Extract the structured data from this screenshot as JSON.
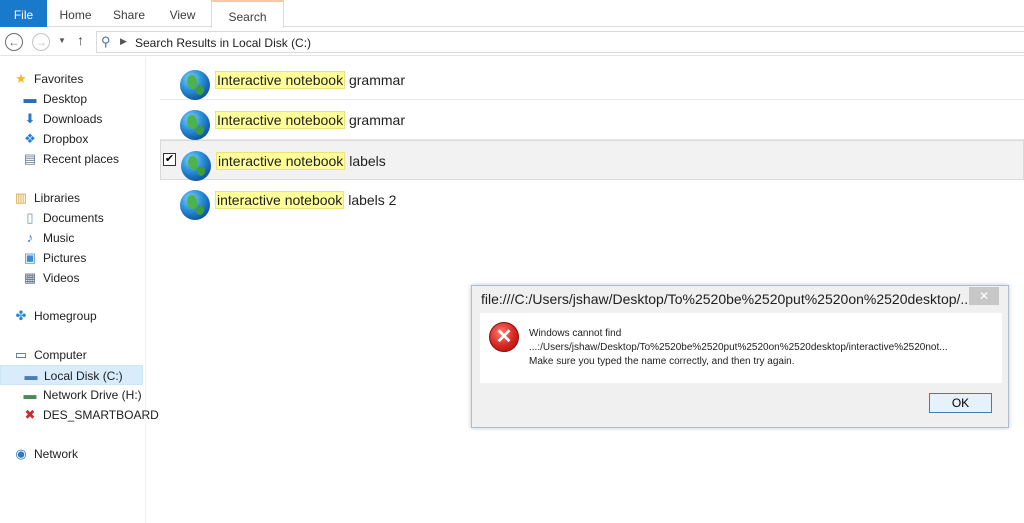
{
  "ribbon": {
    "tabs": [
      "File",
      "Home",
      "Share",
      "View",
      "Search"
    ]
  },
  "address": {
    "path": "Search Results in Local Disk (C:)"
  },
  "navpane": {
    "favorites": {
      "label": "Favorites",
      "items": [
        "Desktop",
        "Downloads",
        "Dropbox",
        "Recent places"
      ]
    },
    "libraries": {
      "label": "Libraries",
      "items": [
        "Documents",
        "Music",
        "Pictures",
        "Videos"
      ]
    },
    "homegroup": {
      "label": "Homegroup"
    },
    "computer": {
      "label": "Computer",
      "items": [
        "Local Disk (C:)",
        "Network Drive (H:)",
        "DES_SMARTBOARD"
      ]
    },
    "network": {
      "label": "Network"
    }
  },
  "results": [
    {
      "match": "Interactive notebook",
      "rest": " grammar"
    },
    {
      "match": "Interactive notebook",
      "rest": " grammar"
    },
    {
      "match": "interactive notebook",
      "rest": " labels"
    },
    {
      "match": "interactive notebook",
      "rest": " labels 2"
    }
  ],
  "dialog": {
    "title": "file:///C:/Users/jshaw/Desktop/To%2520be%2520put%2520on%2520desktop/...",
    "close": "✕",
    "line1": "Windows cannot find",
    "line2": "...:/Users/jshaw/Desktop/To%2520be%2520put%2520on%2520desktop/interactive%2520not...",
    "line3": "Make sure you typed the name correctly, and then try again.",
    "ok": "OK"
  },
  "colors": {
    "file_tab": "#1979ca",
    "highlight": "#ffff99",
    "selected_nav": "#d9ecfb"
  }
}
